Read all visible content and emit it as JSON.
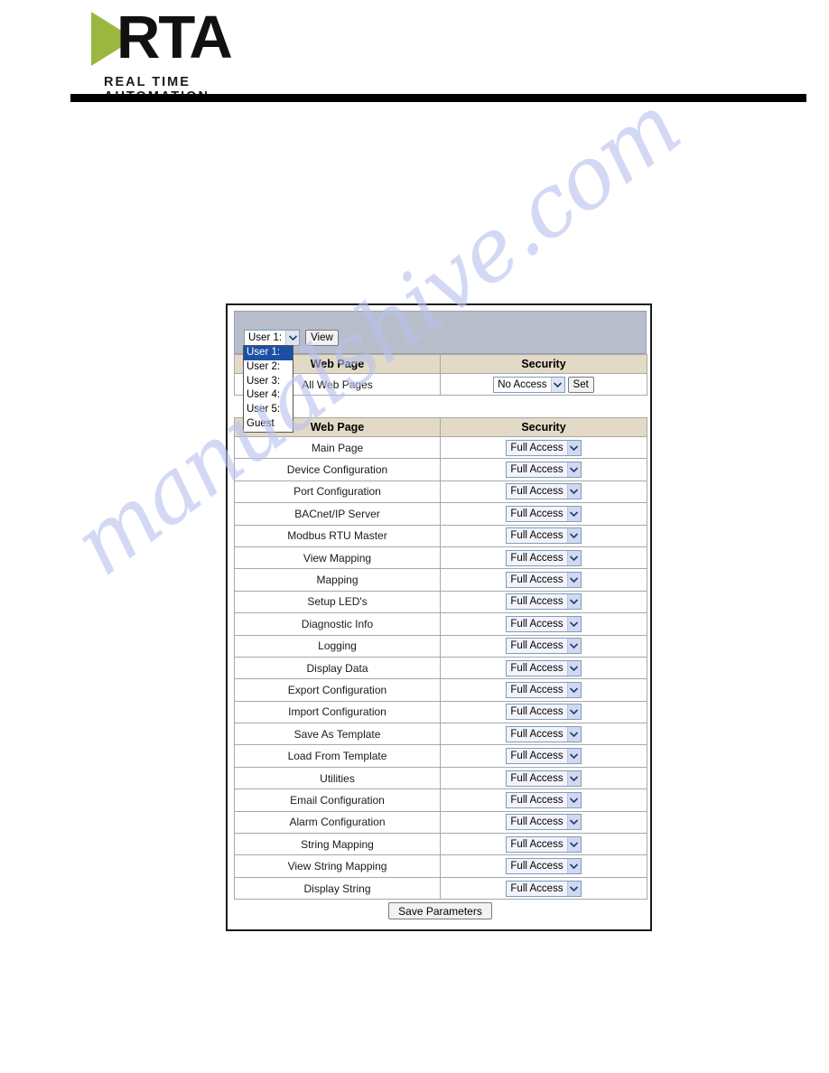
{
  "header": {
    "logo_text": "RTA",
    "logo_tagline": "REAL TIME AUTOMATION",
    "logo_triangle_color": "#9CB73F",
    "rule_color": "#000000"
  },
  "watermark": {
    "text": "manualshive.com",
    "color": "#b9c2ee"
  },
  "panel": {
    "toolbar": {
      "user_select_value": "User 1:",
      "view_button_label": "View",
      "user_options": [
        "User 1:",
        "User 2:",
        "User 3:",
        "User 4:",
        "User 5:",
        "Guest"
      ],
      "user_selected_option": "User 1:",
      "dropdown_open": true,
      "highlight_color": "#1d4fa5"
    },
    "all_pages_table": {
      "headers": [
        "Web Page",
        "Security"
      ],
      "row_label": "All Web Pages",
      "security_value": "No Access",
      "set_button_label": "Set"
    },
    "pages_table": {
      "headers": [
        "Web Page",
        "Security"
      ],
      "rows": [
        {
          "page": "Main Page",
          "security": "Full Access"
        },
        {
          "page": "Device Configuration",
          "security": "Full Access"
        },
        {
          "page": "Port Configuration",
          "security": "Full Access"
        },
        {
          "page": "BACnet/IP Server",
          "security": "Full Access"
        },
        {
          "page": "Modbus RTU Master",
          "security": "Full Access"
        },
        {
          "page": "View Mapping",
          "security": "Full Access"
        },
        {
          "page": "Mapping",
          "security": "Full Access"
        },
        {
          "page": "Setup LED's",
          "security": "Full Access"
        },
        {
          "page": "Diagnostic Info",
          "security": "Full Access"
        },
        {
          "page": "Logging",
          "security": "Full Access"
        },
        {
          "page": "Display Data",
          "security": "Full Access"
        },
        {
          "page": "Export Configuration",
          "security": "Full Access"
        },
        {
          "page": "Import Configuration",
          "security": "Full Access"
        },
        {
          "page": "Save As Template",
          "security": "Full Access"
        },
        {
          "page": "Load From Template",
          "security": "Full Access"
        },
        {
          "page": "Utilities",
          "security": "Full Access"
        },
        {
          "page": "Email Configuration",
          "security": "Full Access"
        },
        {
          "page": "Alarm Configuration",
          "security": "Full Access"
        },
        {
          "page": "String Mapping",
          "security": "Full Access"
        },
        {
          "page": "View String Mapping",
          "security": "Full Access"
        },
        {
          "page": "Display String",
          "security": "Full Access"
        }
      ]
    },
    "save_button_label": "Save Parameters"
  }
}
